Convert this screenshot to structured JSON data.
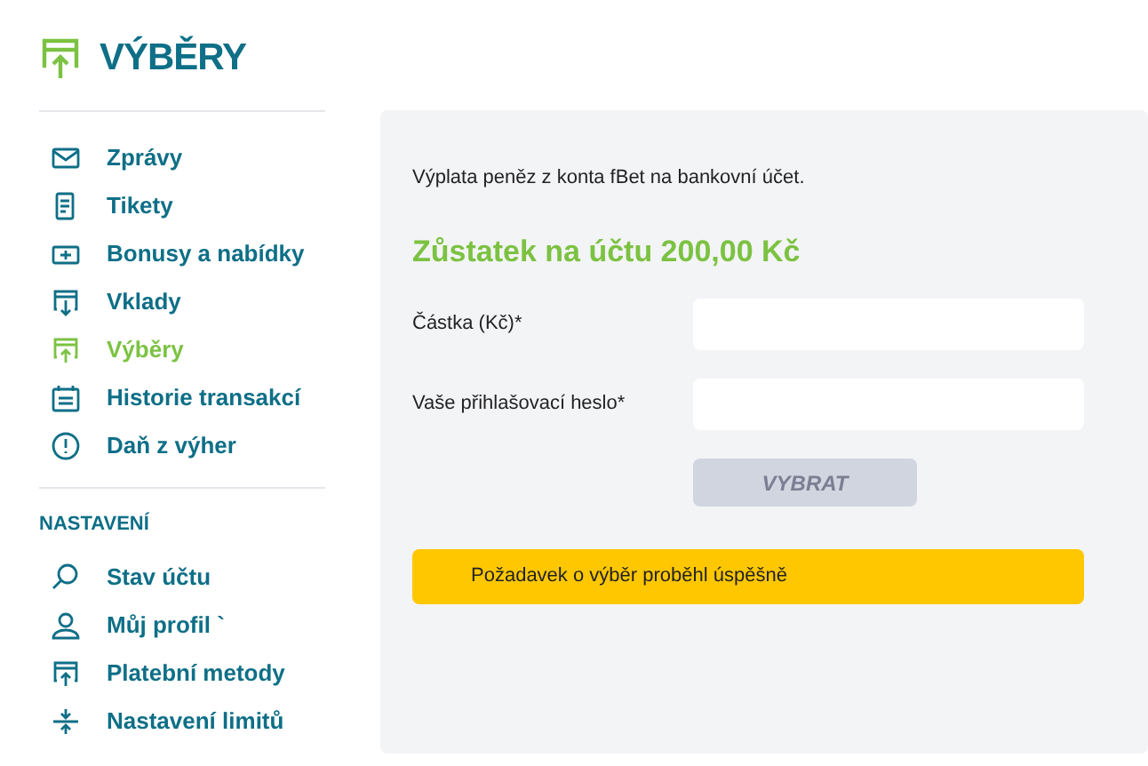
{
  "page_title": "VÝBĚRY",
  "menu": [
    {
      "label": "Zprávy",
      "selected": false
    },
    {
      "label": "Tikety",
      "selected": false
    },
    {
      "label": "Bonusy a nabídky",
      "selected": false
    },
    {
      "label": "Vklady",
      "selected": false
    },
    {
      "label": "Výběry",
      "selected": true
    },
    {
      "label": "Historie transakcí",
      "selected": false
    },
    {
      "label": "Daň z výher",
      "selected": false
    }
  ],
  "settings": {
    "heading": "NASTAVENÍ",
    "items": [
      {
        "label": "Stav účtu",
        "selected": false
      },
      {
        "label": "Můj profil `",
        "selected": false
      },
      {
        "label": "Platební metody",
        "selected": false
      },
      {
        "label": "Nastavení limitů",
        "selected": false
      }
    ]
  },
  "form": {
    "intro": "Výplata peněz z konta fBet na bankovní účet.",
    "balance": "Zůstatek na účtu 200,00 Kč",
    "fields": [
      {
        "label": "Částka (Kč)*"
      },
      {
        "label": "Vaše přihlašovací heslo*"
      }
    ],
    "submit": {
      "label": "VYBRAT",
      "disabled": true
    },
    "alert": "Požadavek o výběr proběhl úspěšně"
  }
}
